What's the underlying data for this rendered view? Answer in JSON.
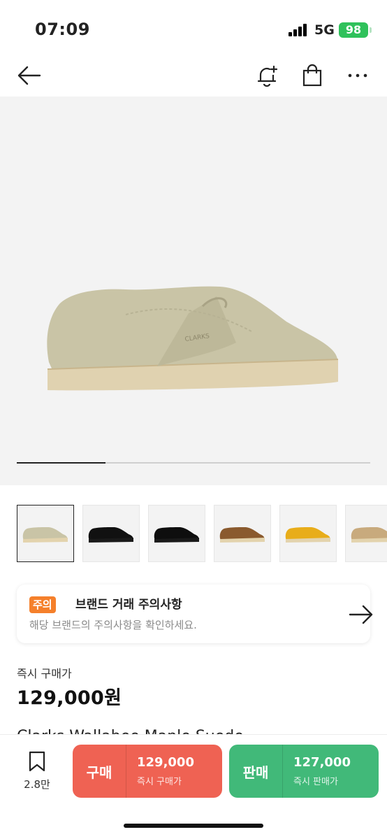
{
  "status": {
    "time": "07:09",
    "network": "5G",
    "battery": "98"
  },
  "nav": {
    "icons": [
      "back-arrow-icon",
      "bell-plus-icon",
      "shopping-bag-icon",
      "more-icon"
    ]
  },
  "gallery": {
    "progress_fraction": 0.25,
    "main_image_color": "#c9c4a6",
    "thumbnail_colors": [
      "#c9c4a6",
      "#111111",
      "#0e0e0e",
      "#8a5a2e",
      "#e8ad1a",
      "#c8aa7d"
    ]
  },
  "notice": {
    "badge": "주의",
    "title": "브랜드 거래 주의사항",
    "subtitle": "해당 브랜드의 주의사항을 확인하세요."
  },
  "price": {
    "label": "즉시 구매가",
    "value": "129,000원"
  },
  "product": {
    "name": "Clarks Wallabee Maple Suede"
  },
  "bottom": {
    "wish_count": "2.8만",
    "buy": {
      "tag": "구매",
      "price": "129,000",
      "sub": "즉시 구매가"
    },
    "sell": {
      "tag": "판매",
      "price": "127,000",
      "sub": "즉시 판매가"
    }
  },
  "colors": {
    "buy": "#ef6253",
    "sell": "#41b979",
    "notice_badge": "#f5802b",
    "battery": "#2fc15b"
  }
}
